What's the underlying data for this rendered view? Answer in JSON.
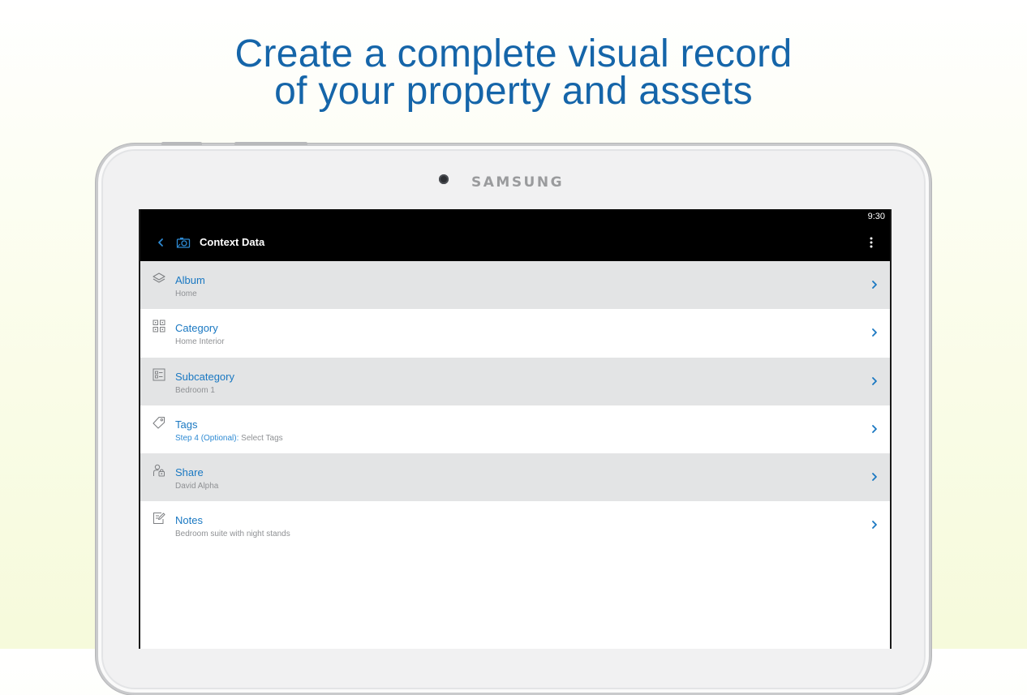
{
  "headline": {
    "line1": "Create a complete visual record",
    "line2": "of your property and assets"
  },
  "device": {
    "brand": "SAMSUNG"
  },
  "status_bar": {
    "time": "9:30"
  },
  "app_bar": {
    "title": "Context Data",
    "back_icon": "chevron-left-icon",
    "app_icon": "camera-icon",
    "menu_icon": "overflow-menu-icon"
  },
  "rows": [
    {
      "title": "Album",
      "subtitle": "Home",
      "icon": "layers-icon"
    },
    {
      "title": "Category",
      "subtitle": "Home Interior",
      "icon": "category-grid-icon"
    },
    {
      "title": "Subcategory",
      "subtitle": "Bedroom 1",
      "icon": "subcategory-list-icon"
    },
    {
      "title": "Tags",
      "subtitle_highlight": "Step 4 (Optional):",
      "subtitle": "Select Tags",
      "icon": "tag-icon"
    },
    {
      "title": "Share",
      "subtitle": "David Alpha",
      "icon": "share-lock-icon"
    },
    {
      "title": "Notes",
      "subtitle": "Bedroom suite with night stands",
      "icon": "notes-edit-icon"
    }
  ],
  "colors": {
    "headline": "#1565a9",
    "row_title": "#1a78c2",
    "row_subtitle": "#8f9194",
    "row_shaded": "#e3e4e5",
    "app_bar": "#000000"
  }
}
